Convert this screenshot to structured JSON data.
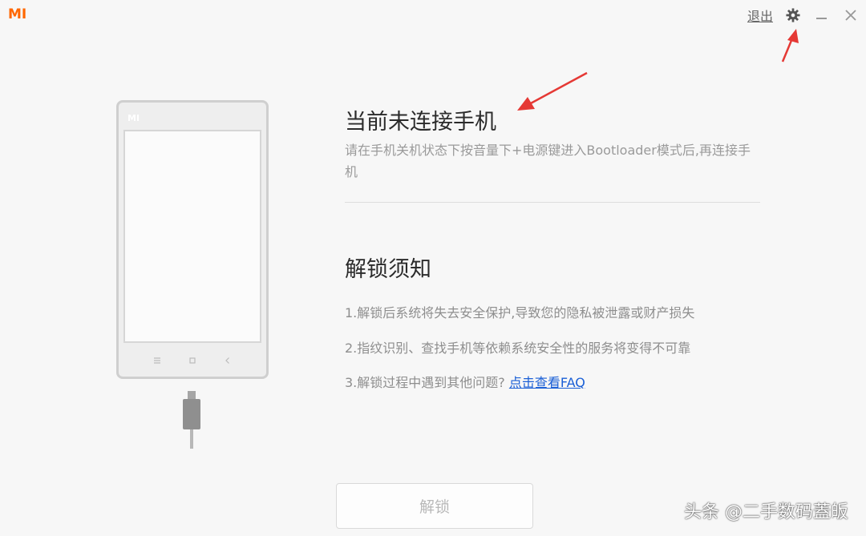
{
  "app": {
    "logo_text": "MI",
    "brand_color": "#ff6700"
  },
  "top_controls": {
    "exit_label": "退出",
    "settings_icon": "gear-icon",
    "minimize_icon": "minimize-icon",
    "close_icon": "close-icon"
  },
  "phone": {
    "logo_text": "MI"
  },
  "status": {
    "title": "当前未连接手机",
    "description": "请在手机关机状态下按音量下+电源键进入Bootloader模式后,再连接手机"
  },
  "notice": {
    "title": "解锁须知",
    "item1": "1.解锁后系统将失去安全保护,导致您的隐私被泄露或财产损失",
    "item2": "2.指纹识别、查找手机等依赖系统安全性的服务将变得不可靠",
    "item3_prefix": "3.解锁过程中遇到其他问题?",
    "item3_link": "点击查看FAQ"
  },
  "unlock_button": {
    "label": "解锁",
    "enabled": false
  },
  "annotation_color": "#e53935",
  "watermark": "头条 @二手数码蓋皈"
}
